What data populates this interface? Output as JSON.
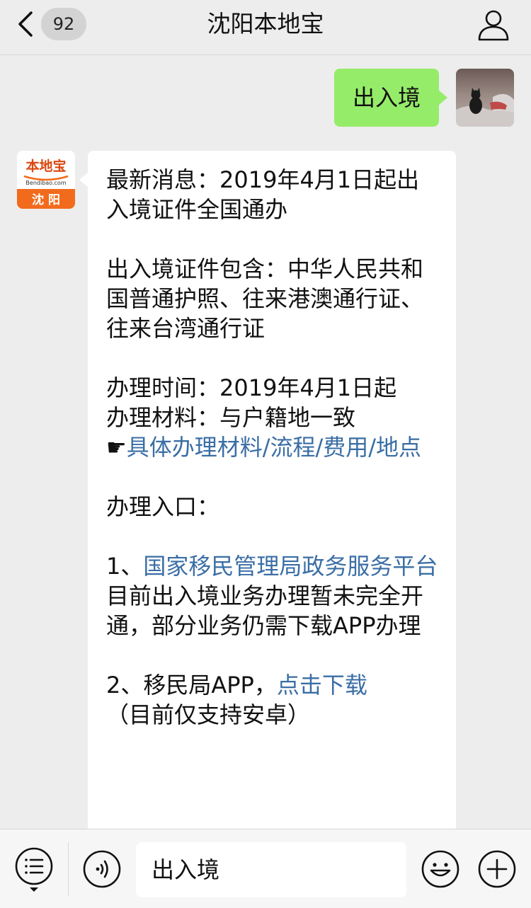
{
  "header": {
    "unread_count": "92",
    "title": "沈阳本地宝"
  },
  "chat": {
    "my_message": "出入境",
    "logo": {
      "brand": "本地宝",
      "domain": "Bendibao.com",
      "city": "沈 阳"
    },
    "reply": {
      "p1": "最新消息：2019年4月1日起出入境证件全国通办",
      "p2": "出入境证件包含：中华人民共和国普通护照、往来港澳通行证、往来台湾通行证",
      "p3_time": "办理时间：2019年4月1日起",
      "p3_material": "办理材料：与户籍地一致",
      "pointer": "☛",
      "link_material": "具体办理材料/流程/费用/地点",
      "entry_label": "办理入口：",
      "item1_prefix": "1、",
      "item1_link": "国家移民管理局政务服务平台",
      "item1_note": "目前出入境业务办理暂未完全开通，部分业务仍需下载APP办理",
      "item2_prefix": "2、移民局APP，",
      "item2_link": "点击下载",
      "item2_note": "（目前仅支持安卓）"
    }
  },
  "input_bar": {
    "text": "出入境"
  },
  "colors": {
    "background": "#ededed",
    "my_bubble": "#95ec69",
    "link": "#3a6ea5",
    "logo_orange": "#f26b1d"
  }
}
